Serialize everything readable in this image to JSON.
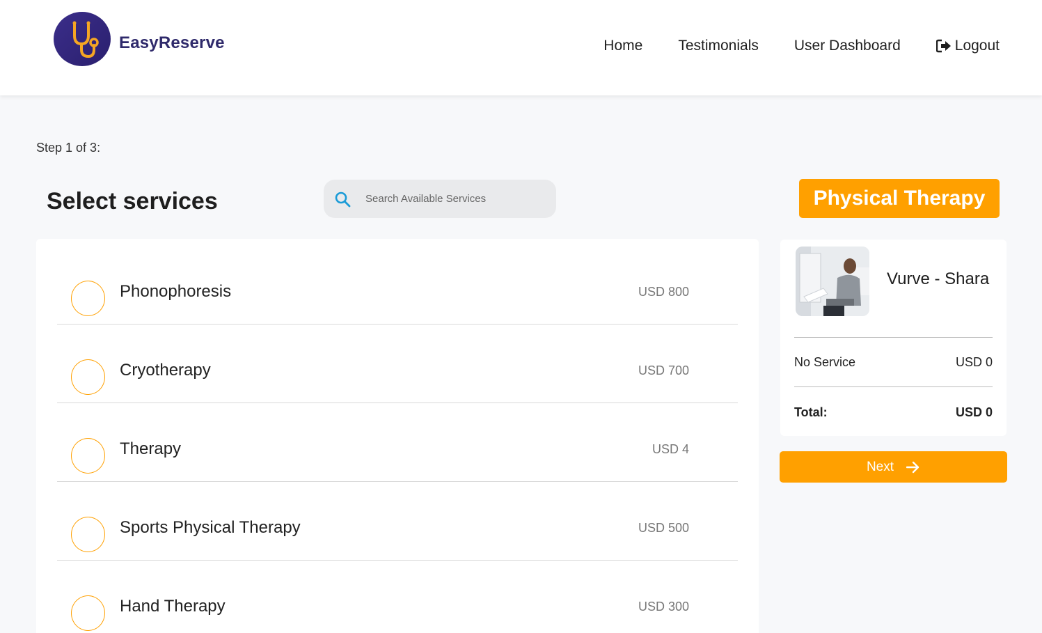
{
  "brand": {
    "name": "EasyReserve",
    "logo_icon": "stethoscope-icon"
  },
  "nav": {
    "items": [
      {
        "label": "Home"
      },
      {
        "label": "Testimonials"
      },
      {
        "label": "User Dashboard"
      },
      {
        "label": "Logout",
        "icon": "logout-icon"
      }
    ]
  },
  "step": {
    "text": "Step 1 of 3:"
  },
  "page": {
    "title": "Select services"
  },
  "search": {
    "placeholder": "Search Available Services",
    "value": "",
    "icon": "search-icon"
  },
  "category": {
    "label": "Physical Therapy"
  },
  "services": [
    {
      "name": "Phonophoresis",
      "price": "USD 800",
      "selected": false
    },
    {
      "name": "Cryotherapy",
      "price": "USD 700",
      "selected": false
    },
    {
      "name": "Therapy",
      "price": "USD 4",
      "selected": false
    },
    {
      "name": "Sports Physical Therapy",
      "price": "USD 500",
      "selected": false
    },
    {
      "name": "Hand Therapy",
      "price": "USD 300",
      "selected": false
    }
  ],
  "summary": {
    "provider_name": "Vurve - Shara",
    "line_item": {
      "label": "No Service",
      "amount": "USD 0"
    },
    "total": {
      "label": "Total:",
      "amount": "USD 0"
    }
  },
  "actions": {
    "next_label": "Next",
    "next_icon": "arrow-right-icon"
  },
  "colors": {
    "accent": "#ffa000",
    "brand": "#2f2a6b",
    "logo_bg": "#3b2e8a",
    "search_icon": "#1a9bd7"
  }
}
